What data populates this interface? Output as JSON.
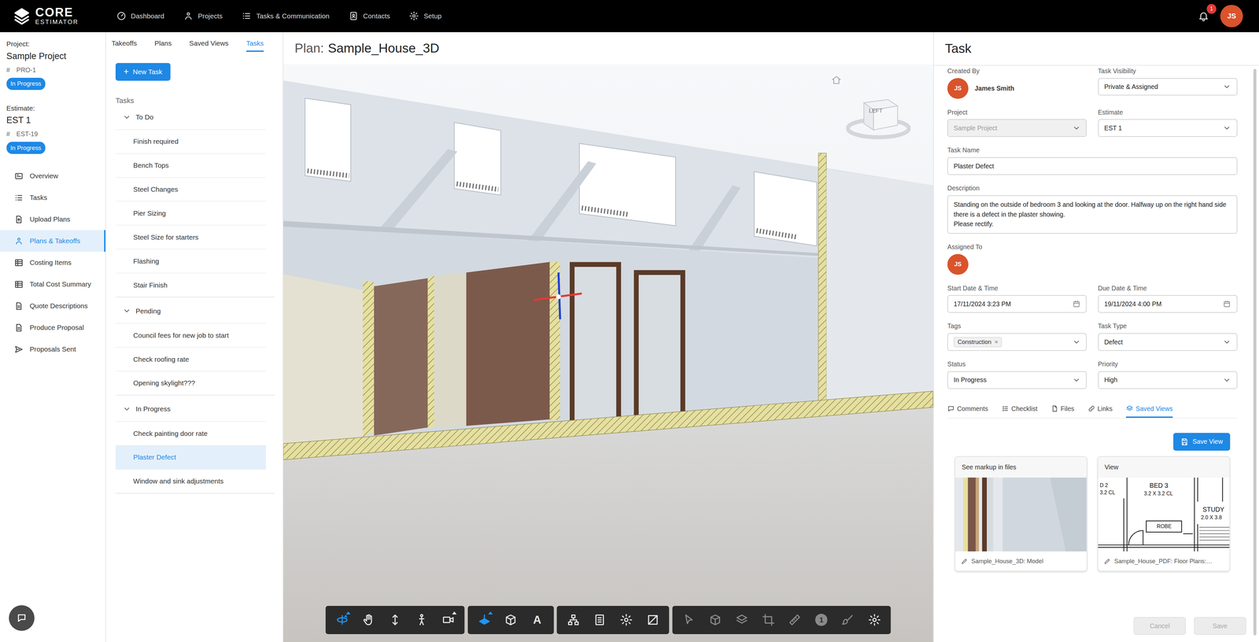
{
  "topbar": {
    "logo": {
      "line1": "CORE",
      "line2": "ESTIMATOR"
    },
    "nav": [
      {
        "label": "Dashboard",
        "selected": false
      },
      {
        "label": "Projects",
        "selected": false
      },
      {
        "label": "Tasks & Communication",
        "selected": false
      },
      {
        "label": "Contacts",
        "selected": false
      },
      {
        "label": "Setup",
        "selected": false
      }
    ],
    "notifications": {
      "count": "1"
    },
    "user": {
      "initials": "JS"
    }
  },
  "sidebar": {
    "project": {
      "label": "Project:",
      "name": "Sample Project",
      "hash": "#",
      "code": "PRO-1",
      "status": "In Progress"
    },
    "estimate": {
      "label": "Estimate:",
      "name": "EST 1",
      "hash": "#",
      "code": "EST-19",
      "status": "In Progress"
    },
    "items": [
      {
        "label": "Overview",
        "selected": false
      },
      {
        "label": "Tasks",
        "selected": false
      },
      {
        "label": "Upload Plans",
        "selected": false
      },
      {
        "label": "Plans & Takeoffs",
        "selected": true
      },
      {
        "label": "Costing Items",
        "selected": false
      },
      {
        "label": "Total Cost Summary",
        "selected": false
      },
      {
        "label": "Quote Descriptions",
        "selected": false
      },
      {
        "label": "Produce Proposal",
        "selected": false
      },
      {
        "label": "Proposals Sent",
        "selected": false
      }
    ]
  },
  "task_list": {
    "tabs": [
      {
        "label": "Takeoffs",
        "selected": false
      },
      {
        "label": "Plans",
        "selected": false
      },
      {
        "label": "Saved Views",
        "selected": false
      },
      {
        "label": "Tasks",
        "selected": true
      }
    ],
    "new_task": {
      "icon": "+",
      "label": "New Task"
    },
    "heading": "Tasks",
    "groups": [
      {
        "title": "To Do",
        "expanded": true,
        "items": [
          {
            "label": "Finish required",
            "selected": false
          },
          {
            "label": "Bench Tops",
            "selected": false
          },
          {
            "label": "Steel Changes",
            "selected": false
          },
          {
            "label": "Pier Sizing",
            "selected": false
          },
          {
            "label": "Steel Size for starters",
            "selected": false
          },
          {
            "label": "Flashing",
            "selected": false
          },
          {
            "label": "Stair Finish",
            "selected": false
          }
        ]
      },
      {
        "title": "Pending",
        "expanded": true,
        "items": [
          {
            "label": "Council fees for new job to start",
            "selected": false
          },
          {
            "label": "Check roofing rate",
            "selected": false
          },
          {
            "label": "Opening skylight???",
            "selected": false
          }
        ]
      },
      {
        "title": "In Progress",
        "expanded": true,
        "items": [
          {
            "label": "Check painting door rate",
            "selected": false
          },
          {
            "label": "Plaster Defect",
            "selected": true
          },
          {
            "label": "Window and sink adjustments",
            "selected": false
          }
        ]
      }
    ]
  },
  "viewer": {
    "title_prefix": "Plan:",
    "title": "Sample_House_3D",
    "viewcube": "LEFT",
    "toolbar": [
      {
        "tools": [
          {
            "kind": "orbit",
            "selected": true,
            "disabled": false,
            "menu": true
          },
          {
            "kind": "pan",
            "selected": false,
            "disabled": false,
            "menu": false
          },
          {
            "kind": "zoom",
            "selected": false,
            "disabled": false,
            "menu": false
          },
          {
            "kind": "walk",
            "selected": false,
            "disabled": false,
            "menu": false
          },
          {
            "kind": "camera",
            "selected": false,
            "disabled": false,
            "menu": true
          }
        ]
      },
      {
        "tools": [
          {
            "kind": "section",
            "selected": true,
            "disabled": false,
            "menu": true
          },
          {
            "kind": "box",
            "selected": false,
            "disabled": false,
            "menu": false
          },
          {
            "kind": "text",
            "label": "A",
            "selected": false,
            "disabled": false,
            "menu": false
          }
        ]
      },
      {
        "tools": [
          {
            "kind": "tree",
            "selected": false,
            "disabled": false,
            "menu": false
          },
          {
            "kind": "props",
            "selected": false,
            "disabled": false,
            "menu": false
          },
          {
            "kind": "settings",
            "selected": false,
            "disabled": false,
            "menu": false
          },
          {
            "kind": "expand",
            "selected": false,
            "disabled": false,
            "menu": false
          }
        ]
      },
      {
        "tools": [
          {
            "kind": "select",
            "selected": false,
            "disabled": true,
            "menu": false
          },
          {
            "kind": "cube",
            "selected": false,
            "disabled": true,
            "menu": false
          },
          {
            "kind": "layers",
            "selected": false,
            "disabled": true,
            "menu": false
          },
          {
            "kind": "crop",
            "selected": false,
            "disabled": true,
            "menu": false
          },
          {
            "kind": "ruler",
            "selected": false,
            "disabled": true,
            "menu": false
          },
          {
            "kind": "count",
            "label": "1",
            "selected": false,
            "disabled": true,
            "menu": false
          },
          {
            "kind": "paint",
            "selected": false,
            "disabled": true,
            "menu": false
          },
          {
            "kind": "settings",
            "selected": false,
            "disabled": false,
            "menu": false
          }
        ]
      }
    ]
  },
  "task": {
    "title": "Task",
    "created_by": {
      "label": "Created By",
      "initials": "JS",
      "name": "James Smith"
    },
    "visibility": {
      "label": "Task Visibility",
      "value": "Private & Assigned",
      "disabled": false
    },
    "project": {
      "label": "Project",
      "value": "Sample Project",
      "disabled": true
    },
    "estimate": {
      "label": "Estimate",
      "value": "EST 1",
      "disabled": false
    },
    "name": {
      "label": "Task Name",
      "value": "Plaster Defect"
    },
    "description": {
      "label": "Description",
      "value": "Standing on the outside of bedroom 3 and looking at the door. Halfway up on the right hand side there is a defect in the plaster showing.\nPlease rectify."
    },
    "assigned": {
      "label": "Assigned To",
      "initials": "JS"
    },
    "start": {
      "label": "Start Date & Time",
      "value": "17/11/2024 3:23 PM"
    },
    "due": {
      "label": "Due Date & Time",
      "value": "19/11/2024 4:00 PM"
    },
    "tags": {
      "label": "Tags",
      "chips": [
        {
          "label": "Construction",
          "remove": "×"
        }
      ]
    },
    "type": {
      "label": "Task Type",
      "value": "Defect",
      "disabled": false
    },
    "status": {
      "label": "Status",
      "value": "In Progress",
      "disabled": false
    },
    "priority": {
      "label": "Priority",
      "value": "High",
      "disabled": false
    },
    "tabs": [
      {
        "label": "Comments",
        "selected": false
      },
      {
        "label": "Checklist",
        "selected": false
      },
      {
        "label": "Files",
        "selected": false
      },
      {
        "label": "Links",
        "selected": false
      },
      {
        "label": "Saved Views",
        "selected": true
      }
    ],
    "save_view": "Save View",
    "views": [
      {
        "title": "See markup in files",
        "kind": "model",
        "source": "Sample_House_3D: Model",
        "labels": []
      },
      {
        "title": "View",
        "kind": "plan",
        "source": "Sample_House_PDF: Floor Plans:…",
        "labels": [
          "D 2",
          "3.2 CL",
          "BED 3",
          "3.2 X 3.2 CL",
          "STUDY",
          "2.0 X 3.8",
          "ROBE"
        ]
      }
    ],
    "actions": [
      {
        "label": "Cancel",
        "disabled": true
      },
      {
        "label": "Save",
        "disabled": true
      }
    ]
  }
}
